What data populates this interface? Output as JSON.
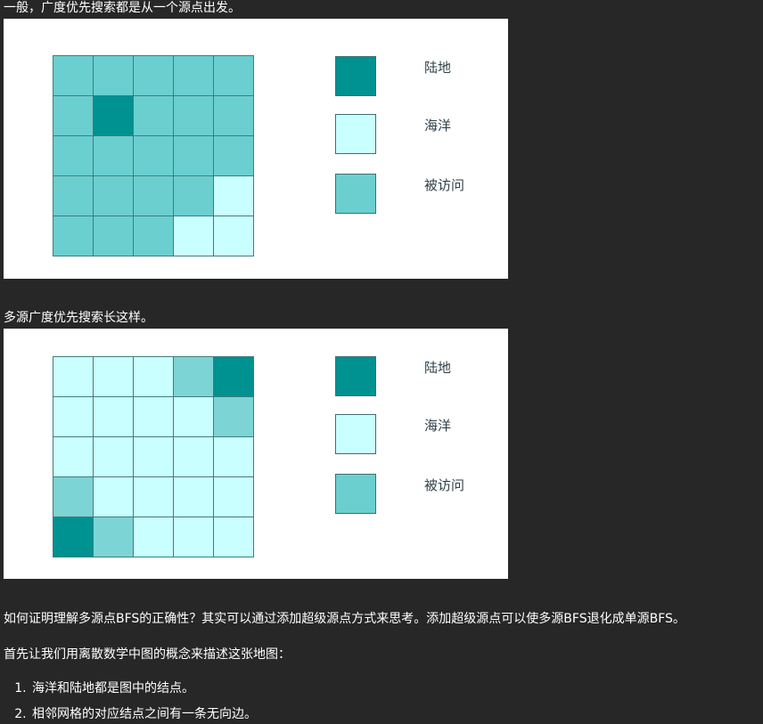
{
  "colors": {
    "land": "#009191",
    "ocean": "#caffff",
    "visited": "#6bcfcf",
    "visited_light": "#7dd4d4",
    "page_bg": "#272727"
  },
  "intro_text": "一般，广度优先搜索都是从一个源点出发。",
  "single_source_figure": {
    "grid": [
      [
        "visited",
        "visited",
        "visited",
        "visited",
        "visited"
      ],
      [
        "visited",
        "land",
        "visited",
        "visited",
        "visited"
      ],
      [
        "visited",
        "visited",
        "visited",
        "visited",
        "visited"
      ],
      [
        "visited",
        "visited",
        "visited",
        "visited",
        "ocean"
      ],
      [
        "visited",
        "visited",
        "visited",
        "ocean",
        "ocean"
      ]
    ],
    "legend": [
      {
        "label": "陆地",
        "color_key": "land"
      },
      {
        "label": "海洋",
        "color_key": "ocean"
      },
      {
        "label": "被访问",
        "color_key": "visited"
      }
    ]
  },
  "multi_source_text": "多源广度优先搜索长这样。",
  "multi_source_figure": {
    "grid": [
      [
        "ocean",
        "ocean",
        "ocean",
        "visited_light",
        "land"
      ],
      [
        "ocean",
        "ocean",
        "ocean",
        "ocean",
        "visited_light"
      ],
      [
        "ocean",
        "ocean",
        "ocean",
        "ocean",
        "ocean"
      ],
      [
        "visited_light",
        "ocean",
        "ocean",
        "ocean",
        "ocean"
      ],
      [
        "land",
        "visited_light",
        "ocean",
        "ocean",
        "ocean"
      ]
    ],
    "legend": [
      {
        "label": "陆地",
        "color_key": "land"
      },
      {
        "label": "海洋",
        "color_key": "ocean"
      },
      {
        "label": "被访问",
        "color_key": "visited"
      }
    ]
  },
  "proof_question": "如何证明理解多源点BFS的正确性？其实可以通过添加超级源点方式来思考。添加超级源点可以使多源BFS退化成单源BFS。",
  "graph_intro": "首先让我们用离散数学中图的概念来描述这张地图：",
  "steps": [
    "海洋和陆地都是图中的结点。",
    "相邻网格的对应结点之间有一条无向边。"
  ]
}
